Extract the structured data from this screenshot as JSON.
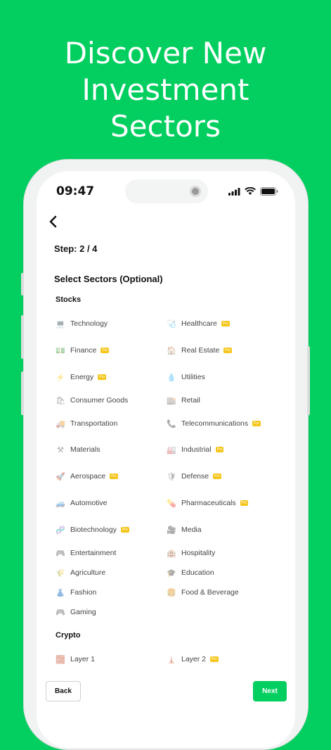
{
  "headline": {
    "line1": "Discover New",
    "line2": "Investment",
    "line3": "Sectors"
  },
  "status_bar": {
    "time": "09:47"
  },
  "step": "Step: 2 / 4",
  "section_title": "Select Sectors (Optional)",
  "pro_badge": "Pro",
  "groups": {
    "stocks": {
      "label": "Stocks",
      "items": [
        {
          "label": "Technology",
          "icon": "💻",
          "pro": false
        },
        {
          "label": "Healthcare",
          "icon": "🩺",
          "pro": true
        },
        {
          "label": "Finance",
          "icon": "💵",
          "pro": true
        },
        {
          "label": "Real Estate",
          "icon": "🏠",
          "pro": true
        },
        {
          "label": "Energy",
          "icon": "⚡",
          "pro": true
        },
        {
          "label": "Utilities",
          "icon": "💧",
          "pro": false
        },
        {
          "label": "Consumer Goods",
          "icon": "🛍",
          "pro": false
        },
        {
          "label": "Retail",
          "icon": "🏬",
          "pro": false
        },
        {
          "label": "Transportation",
          "icon": "🚚",
          "pro": false
        },
        {
          "label": "Telecommunications",
          "icon": "📞",
          "pro": true
        },
        {
          "label": "Materials",
          "icon": "⚒",
          "pro": false
        },
        {
          "label": "Industrial",
          "icon": "🏭",
          "pro": true
        },
        {
          "label": "Aerospace",
          "icon": "🚀",
          "pro": true
        },
        {
          "label": "Defense",
          "icon": "🛡",
          "pro": true
        },
        {
          "label": "Automotive",
          "icon": "🚙",
          "pro": false
        },
        {
          "label": "Pharmaceuticals",
          "icon": "💊",
          "pro": true
        },
        {
          "label": "Biotechnology",
          "icon": "🧬",
          "pro": true
        },
        {
          "label": "Media",
          "icon": "🎥",
          "pro": false
        },
        {
          "label": "Entertainment",
          "icon": "🎮",
          "pro": false
        },
        {
          "label": "Hospitality",
          "icon": "🏨",
          "pro": false
        },
        {
          "label": "Agriculture",
          "icon": "🌾",
          "pro": false
        },
        {
          "label": "Education",
          "icon": "🎓",
          "pro": false
        },
        {
          "label": "Fashion",
          "icon": "👗",
          "pro": false
        },
        {
          "label": "Food & Beverage",
          "icon": "🍔",
          "pro": false
        },
        {
          "label": "Gaming",
          "icon": "🎮",
          "pro": false
        }
      ]
    },
    "crypto": {
      "label": "Crypto",
      "items": [
        {
          "label": "Layer 1",
          "icon": "🧱",
          "pro": false
        },
        {
          "label": "Layer 2",
          "icon": "🗼",
          "pro": true
        }
      ]
    }
  },
  "buttons": {
    "back": "Back",
    "next": "Next"
  }
}
